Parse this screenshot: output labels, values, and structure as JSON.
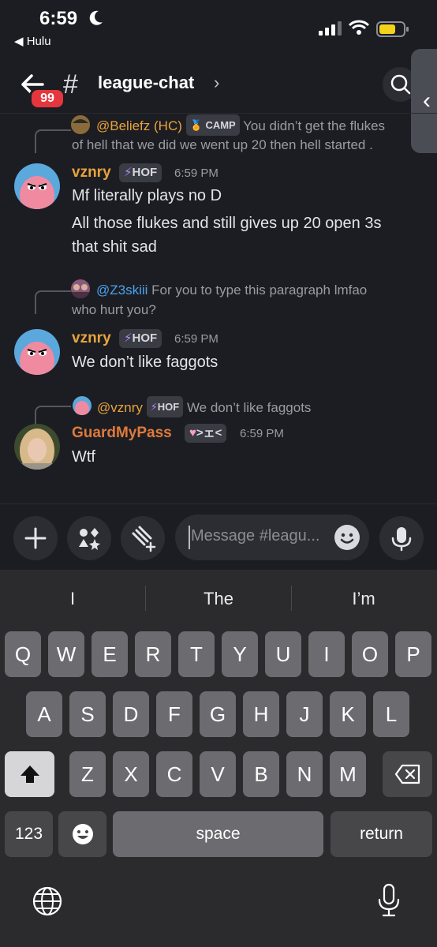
{
  "status_bar": {
    "time": "6:59",
    "back_app": "Hulu"
  },
  "header": {
    "badge_count": "99",
    "channel": "league-chat"
  },
  "messages": [
    {
      "reply": {
        "user": "@Beliefz (HC)",
        "tag": "CAMP",
        "text1": "You didn’t get the flukes",
        "text2": "of hell that we did we went up 20 then hell started ."
      },
      "author": "vznry",
      "tag": "HOF",
      "time": "6:59 PM",
      "lines": [
        "Mf literally plays no D",
        "All those flukes and still gives up 20 open 3s",
        "that shit sad"
      ]
    },
    {
      "reply": {
        "user": "@Z3skiii",
        "text1": "For you to type this paragraph lmfao",
        "text2": "who hurt you?"
      },
      "author": "vznry",
      "tag": "HOF",
      "time": "6:59 PM",
      "lines": [
        "We don’t like faggots"
      ]
    },
    {
      "reply": {
        "user": "@vznry",
        "tag": "HOF",
        "text1": "We don’t like faggots"
      },
      "author": "GuardMyPass",
      "tag": ">ェ<",
      "time": "6:59 PM",
      "lines": [
        "Wtf"
      ]
    }
  ],
  "composer": {
    "placeholder": "Message #leagu..."
  },
  "keyboard": {
    "suggestions": [
      "I",
      "The",
      "I’m"
    ],
    "row1": [
      "Q",
      "W",
      "E",
      "R",
      "T",
      "Y",
      "U",
      "I",
      "O",
      "P"
    ],
    "row2": [
      "A",
      "S",
      "D",
      "F",
      "G",
      "H",
      "J",
      "K",
      "L"
    ],
    "row3": [
      "Z",
      "X",
      "C",
      "V",
      "B",
      "N",
      "M"
    ],
    "numbers": "123",
    "space": "space",
    "return": "return"
  },
  "colors": {
    "accent_orange": "#e8a33d",
    "mention_blue": "#4aa3f0",
    "badge_red": "#e5363d",
    "guard_name": "#e07a3c"
  }
}
